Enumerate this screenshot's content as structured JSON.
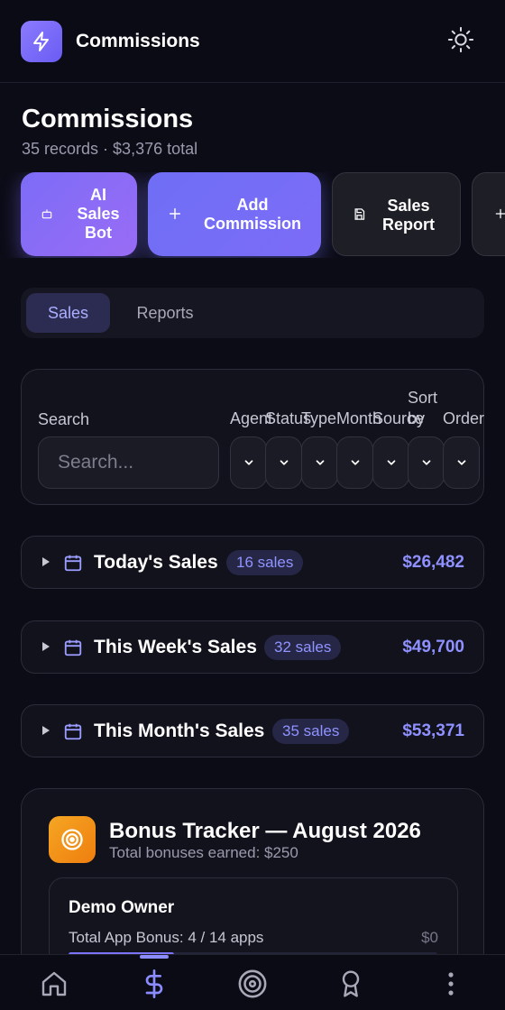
{
  "header": {
    "title": "Commissions",
    "logo_icon": "lightning-icon",
    "theme_icon": "sun-icon"
  },
  "page": {
    "title": "Commissions",
    "records": "35 records",
    "separator": "·",
    "total": "$3,376 total"
  },
  "actions": [
    {
      "label": "AI Sales Bot",
      "icon": "robot-icon"
    },
    {
      "label": "Add Commission",
      "icon": "plus-icon"
    },
    {
      "label": "Sales Report",
      "icon": "save-icon"
    },
    {
      "label": "",
      "icon": "plus-icon"
    }
  ],
  "tabs": [
    {
      "label": "Sales",
      "active": true
    },
    {
      "label": "Reports",
      "active": false
    }
  ],
  "filters": {
    "search_label": "Search",
    "search_placeholder": "Search...",
    "agent": "Agent",
    "status": "Status",
    "type": "Type",
    "month": "Month",
    "source": "Source",
    "sort_by_1": "Sort",
    "sort_by_2": "by",
    "order": "Order"
  },
  "groups": [
    {
      "title": "Today's Sales",
      "badge": "16 sales",
      "amount": "$26,482"
    },
    {
      "title": "This Week's Sales",
      "badge": "32 sales",
      "amount": "$49,700"
    },
    {
      "title": "This Month's Sales",
      "badge": "35 sales",
      "amount": "$53,371"
    }
  ],
  "bonus": {
    "title": "Bonus Tracker — August 2026",
    "subtitle": "Total bonuses earned: $250",
    "owner": "Demo Owner",
    "line": "Total App Bonus: 4 / 14 apps",
    "value": "$0",
    "progress": 0.286
  },
  "nav": [
    "home-icon",
    "dollar-icon",
    "target-icon",
    "award-icon",
    "more-vertical-icon"
  ],
  "colors": {
    "accent": "#7c6cf7",
    "background": "#0c0c17",
    "badge_text": "#8f94ff",
    "bonus_orange": "#f5a623"
  }
}
